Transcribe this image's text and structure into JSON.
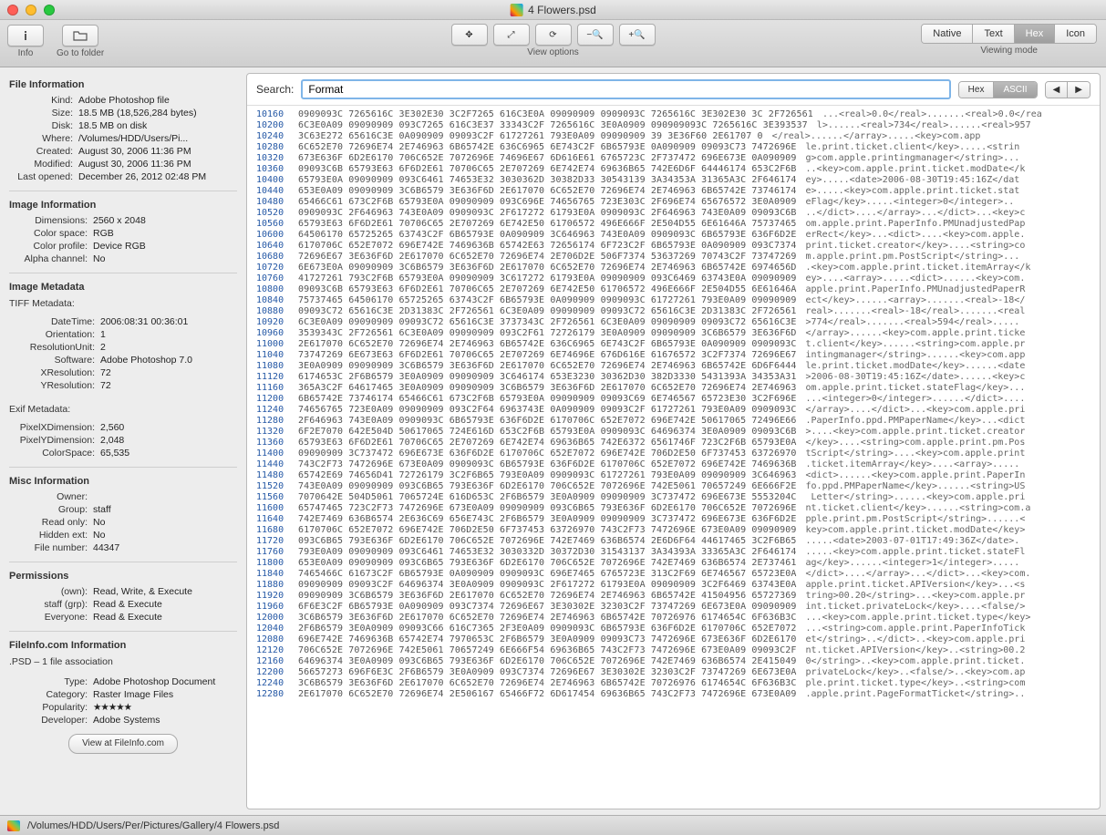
{
  "window": {
    "title": "4 Flowers.psd"
  },
  "toolbar": {
    "info_label": "Info",
    "folder_label": "Go to folder",
    "view_options_label": "View options",
    "viewing_mode_label": "Viewing mode",
    "modes": [
      "Native",
      "Text",
      "Hex",
      "Icon"
    ],
    "active_mode": "Hex"
  },
  "search": {
    "label": "Search:",
    "value": "Format",
    "type_options": [
      "Hex",
      "ASCII"
    ],
    "active_type": "ASCII"
  },
  "sidebar": {
    "file_info_header": "File Information",
    "file_info": {
      "Kind": "Adobe Photoshop file",
      "Size": "18.5 MB (18,526,284 bytes)",
      "Disk": "18.5 MB on disk",
      "Where": "/Volumes/HDD/Users/Pi...",
      "Created": "August 30, 2006 11:36 PM",
      "Modified": "August 30, 2006 11:36 PM",
      "Last opened": "December 26, 2012 02:48 PM"
    },
    "image_info_header": "Image Information",
    "image_info": {
      "Dimensions": "2560 x 2048",
      "Color space": "RGB",
      "Color profile": "Device RGB",
      "Alpha channel": "No"
    },
    "meta_header": "Image Metadata",
    "tiff_label": "TIFF Metadata:",
    "tiff": {
      "DateTime": "2006:08:31 00:36:01",
      "Orientation": "1",
      "ResolutionUnit": "2",
      "Software": "Adobe Photoshop 7.0",
      "XResolution": "72",
      "YResolution": "72"
    },
    "exif_label": "Exif Metadata:",
    "exif": {
      "PixelXDimension": "2,560",
      "PixelYDimension": "2,048",
      "ColorSpace": "65,535"
    },
    "misc_header": "Misc Information",
    "misc": {
      "Owner": "",
      "Group": "staff",
      "Read only": "No",
      "Hidden ext": "No",
      "File number": "44347"
    },
    "perm_header": "Permissions",
    "perm": {
      "(own)": "Read, Write, & Execute",
      "staff (grp)": "Read & Execute",
      "Everyone": "Read & Execute"
    },
    "fi_header": "FileInfo.com Information",
    "fi_assoc": ".PSD – 1 file association",
    "fi": {
      "Type": "Adobe Photoshop Document",
      "Category": "Raster Image Files",
      "Popularity": "★★★★★",
      "Developer": "Adobe Systems"
    },
    "fi_button": "View at FileInfo.com"
  },
  "hex": {
    "rows": [
      {
        "o": "10160",
        "b": "0909093C 7265616C 3E302E30 3C2F7265 616C3E0A 09090909 0909093C 7265616C 3E302E30 3C 2F726561",
        "a": "...<real>0.0</real>.......<real>0.0</rea"
      },
      {
        "o": "10200",
        "b": "6C3E0A09 09090909 093C7265 616C3E37 33343C2F 7265616C 3E0A0909 090909093C 7265616C 3E393537",
        "a": "l>......<real>734</real>......<real>957"
      },
      {
        "o": "10240",
        "b": "3C63E272 65616C3E 0A090909 09093C2F 61727261 793E0A09 09090909 39 3E36F60 2E61707 0",
        "a": "</real>......</array>.....<key>com.app"
      },
      {
        "o": "10280",
        "b": "6C652E70 72696E74 2E746963 6B65742E 636C6965 6E743C2F 6B65793E 0A090909 09093C73 7472696E",
        "a": "le.print.ticket.client</key>.....<strin"
      },
      {
        "o": "10320",
        "b": "673E636F 6D2E6170 706C652E 7072696E 74696E67 6D616E61 6765723C 2F737472 696E673E 0A090909",
        "a": "g>com.apple.printingmanager</string>..."
      },
      {
        "o": "10360",
        "b": "09093C6B 65793E63 6F6D2E61 70706C65 2E707269 6E742E74 69636B65 742E6D6F 64446174 653C2F6B",
        "a": "..<key>com.apple.print.ticket.modDate</k"
      },
      {
        "o": "10400",
        "b": "65793E0A 09090909 093C6461 74653E32 3030362D 30382D33 30543139 3A34353A 31365A3C 2F646174",
        "a": "ey>.....<date>2006-08-30T19:45:16Z</dat"
      },
      {
        "o": "10440",
        "b": "653E0A09 09090909 3C6B6579 3E636F6D 2E617070 6C652E70 72696E74 2E746963 6B65742E 73746174",
        "a": "e>.....<key>com.apple.print.ticket.stat"
      },
      {
        "o": "10480",
        "b": "65466C61 673C2F6B 65793E0A 09090909 093C696E 74656765 723E303C 2F696E74 65676572 3E0A0909",
        "a": "eFlag</key>.....<integer>0</integer>.."
      },
      {
        "o": "10520",
        "b": "0909093C 2F646963 743E0A09 0909093C 2F617272 61793E0A 0909093C 2F646963 743E0A09 09093C6B",
        "a": "..</dict>....</array>...</dict>...<key>c"
      },
      {
        "o": "10560",
        "b": "65793E63 6F6D2E61 70706C65 2E707269 6E742E50 61706572 496E666F 2E504D55 6E61646A 75737465",
        "a": "om.apple.print.PaperInfo.PMUnadjustedPap"
      },
      {
        "o": "10600",
        "b": "64506170 65725265 63743C2F 6B65793E 0A090909 3C646963 743E0A09 0909093C 6B65793E 636F6D2E",
        "a": "erRect</key>...<dict>....<key>com.apple."
      },
      {
        "o": "10640",
        "b": "6170706C 652E7072 696E742E 7469636B 65742E63 72656174 6F723C2F 6B65793E 0A090909 093C7374",
        "a": "print.ticket.creator</key>....<string>co"
      },
      {
        "o": "10680",
        "b": "72696E67 3E636F6D 2E617070 6C652E70 72696E74 2E706D2E 506F7374 53637269 70743C2F 73747269",
        "a": "m.apple.print.pm.PostScript</string>..."
      },
      {
        "o": "10720",
        "b": "6E673E0A 09090909 3C6B6579 3E636F6D 2E617070 6C652E70 72696E74 2E746963 6B65742E 6974656D",
        "a": ".<key>com.apple.print.ticket.itemArray</k"
      },
      {
        "o": "10760",
        "b": "41727261 793C2F6B 65793E0A 09090909 3C617272 61793E0A 09090909 093C6469 63743E0A 09090909",
        "a": "ey>....<array>.....<dict>......<key>com."
      },
      {
        "o": "10800",
        "b": "09093C6B 65793E63 6F6D2E61 70706C65 2E707269 6E742E50 61706572 496E666F 2E504D55 6E61646A",
        "a": "apple.print.PaperInfo.PMUnadjustedPaperR"
      },
      {
        "o": "10840",
        "b": "75737465 64506170 65725265 63743C2F 6B65793E 0A090909 0909093C 61727261 793E0A09 09090909",
        "a": "ect</key>......<array>.......<real>-18</"
      },
      {
        "o": "10880",
        "b": "09093C72 65616C3E 2D31383C 2F726561 6C3E0A09 09090909 09093C72 65616C3E 2D31383C 2F726561",
        "a": "real>.......<real>-18</real>.......<real"
      },
      {
        "o": "10920",
        "b": "6C3E0A09 09090909 09093C72 65616C3E 3737343C 2F726561 6C3E0A09 09090909 09093C72 65616C3E",
        "a": ">774</real>.......<real>594</real>....."
      },
      {
        "o": "10960",
        "b": "3539343C 2F726561 6C3E0A09 09090909 093C2F61 72726179 3E0A0909 09090909 3C6B6579 3E636F6D",
        "a": "</array>......<key>com.apple.print.ticke"
      },
      {
        "o": "11000",
        "b": "2E617070 6C652E70 72696E74 2E746963 6B65742E 636C6965 6E743C2F 6B65793E 0A090909 0909093C",
        "a": "t.client</key>......<string>com.apple.pr"
      },
      {
        "o": "11040",
        "b": "73747269 6E673E63 6F6D2E61 70706C65 2E707269 6E74696E 676D616E 61676572 3C2F7374 72696E67",
        "a": "intingmanager</string>......<key>com.app"
      },
      {
        "o": "11080",
        "b": "3E0A0909 09090909 3C6B6579 3E636F6D 2E617070 6C652E70 72696E74 2E746963 6B65742E 6D6F6444",
        "a": "le.print.ticket.modDate</key>......<date"
      },
      {
        "o": "11120",
        "b": "6174653C 2F6B6579 3E0A0909 09090909 3C646174 653E3230 30362D30 382D3330 5431393A 34353A31",
        "a": ">2006-08-30T19:45:16Z</date>......<key>c"
      },
      {
        "o": "11160",
        "b": "365A3C2F 64617465 3E0A0909 09090909 3C6B6579 3E636F6D 2E617070 6C652E70 72696E74 2E746963",
        "a": "om.apple.print.ticket.stateFlag</key>..."
      },
      {
        "o": "11200",
        "b": "6B65742E 73746174 65466C61 673C2F6B 65793E0A 09090909 09093C69 6E746567 65723E30 3C2F696E",
        "a": "...<integer>0</integer>......</dict>...."
      },
      {
        "o": "11240",
        "b": "74656765 723E0A09 09090909 093C2F64 6963743E 0A090909 09093C2F 61727261 793E0A09 0909093C",
        "a": "</array>....</dict>...<key>com.apple.pri"
      },
      {
        "o": "11280",
        "b": "2F646963 743E0A09 0909093C 6B65793E 636F6D2E 6170706C 652E7072 696E742E 50617065 72496E66",
        "a": ".PaperInfo.ppd.PMPaperName</key>...<dict"
      },
      {
        "o": "11320",
        "b": "6F2E7070 642E504D 50617065 724E616D 653C2F6B 65793E0A 0909093C 64696374 3E0A0909 09093C6B",
        "a": ">....<key>com.apple.print.ticket.creator"
      },
      {
        "o": "11360",
        "b": "65793E63 6F6D2E61 70706C65 2E707269 6E742E74 69636B65 742E6372 6561746F 723C2F6B 65793E0A",
        "a": "</key>....<string>com.apple.print.pm.Pos"
      },
      {
        "o": "11400",
        "b": "09090909 3C737472 696E673E 636F6D2E 6170706C 652E7072 696E742E 706D2E50 6F737453 63726970",
        "a": "tScript</string>....<key>com.apple.print"
      },
      {
        "o": "11440",
        "b": "743C2F73 7472696E 673E0A09 0909093C 6B65793E 636F6D2E 6170706C 652E7072 696E742E 7469636B",
        "a": ".ticket.itemArray</key>....<array>....."
      },
      {
        "o": "11480",
        "b": "65742E69 74656D41 72726179 3C2F6B65 793E0A09 0909093C 61727261 793E0A09 09090909 3C646963",
        "a": "<dict>......<key>com.apple.print.PaperIn"
      },
      {
        "o": "11520",
        "b": "743E0A09 09090909 093C6B65 793E636F 6D2E6170 706C652E 7072696E 742E5061 70657249 6E666F2E",
        "a": "fo.ppd.PMPaperName</key>......<string>US"
      },
      {
        "o": "11560",
        "b": "7070642E 504D5061 7065724E 616D653C 2F6B6579 3E0A0909 09090909 3C737472 696E673E 5553204C",
        "a": " Letter</string>......<key>com.apple.pri"
      },
      {
        "o": "11600",
        "b": "65747465 723C2F73 7472696E 673E0A09 09090909 093C6B65 793E636F 6D2E6170 706C652E 7072696E",
        "a": "nt.ticket.client</key>......<string>com.a"
      },
      {
        "o": "11640",
        "b": "742E7469 636B6574 2E636C69 656E743C 2F6B6579 3E0A0909 09090909 3C737472 696E673E 636F6D2E",
        "a": "pple.print.pm.PostScript</string>......<"
      },
      {
        "o": "11680",
        "b": "6170706C 652E7072 696E742E 706D2E50 6F737453 63726970 743C2F73 7472696E 673E0A09 09090909",
        "a": "key>com.apple.print.ticket.modDate</key>"
      },
      {
        "o": "11720",
        "b": "093C6B65 793E636F 6D2E6170 706C652E 7072696E 742E7469 636B6574 2E6D6F64 44617465 3C2F6B65",
        "a": ".....<date>2003-07-01T17:49:36Z</date>."
      },
      {
        "o": "11760",
        "b": "793E0A09 09090909 093C6461 74653E32 3030332D 30372D30 31543137 3A34393A 33365A3C 2F646174",
        "a": ".....<key>com.apple.print.ticket.stateFl"
      },
      {
        "o": "11800",
        "b": "653E0A09 09090909 093C6B65 793E636F 6D2E6170 706C652E 7072696E 742E7469 636B6574 2E737461",
        "a": "ag</key>......<integer>1</integer>....."
      },
      {
        "o": "11840",
        "b": "7465466C 61673C2F 6B65793E 0A090909 0909093C 696E7465 6765723E 313C2F69 6E746567 65723E0A",
        "a": "</dict>....</array>...</dict>...<key>com."
      },
      {
        "o": "11880",
        "b": "09090909 09093C2F 64696374 3E0A0909 0909093C 2F617272 61793E0A 09090909 3C2F6469 63743E0A",
        "a": "apple.print.ticket.APIVersion</key>...<s"
      },
      {
        "o": "11920",
        "b": "09090909 3C6B6579 3E636F6D 2E617070 6C652E70 72696E74 2E746963 6B65742E 41504956 65727369",
        "a": "tring>00.20</string>...<key>com.apple.pr"
      },
      {
        "o": "11960",
        "b": "6F6E3C2F 6B65793E 0A090909 093C7374 72696E67 3E30302E 32303C2F 73747269 6E673E0A 09090909",
        "a": "int.ticket.privateLock</key>....<false/>"
      },
      {
        "o": "12000",
        "b": "3C6B6579 3E636F6D 2E617070 6C652E70 72696E74 2E746963 6B65742E 70726976 6174654C 6F636B3C",
        "a": "...<key>com.apple.print.ticket.type</key>"
      },
      {
        "o": "12040",
        "b": "2F6B6579 3E0A0909 09093C66 616C7365 2F3E0A09 0909093C 6B65793E 636F6D2E 6170706C 652E7072",
        "a": "...<string>com.apple.print.PaperInfoTick"
      },
      {
        "o": "12080",
        "b": "696E742E 7469636B 65742E74 7970653C 2F6B6579 3E0A0909 09093C73 7472696E 673E636F 6D2E6170",
        "a": "et</string>..</dict>..<key>com.apple.pri"
      },
      {
        "o": "12120",
        "b": "706C652E 7072696E 742E5061 70657249 6E666F54 69636B65 743C2F73 7472696E 673E0A09 09093C2F",
        "a": "nt.ticket.APIVersion</key>..<string>00.2"
      },
      {
        "o": "12160",
        "b": "64696374 3E0A0909 093C6B65 793E636F 6D2E6170 706C652E 7072696E 742E7469 636B6574 2E415049",
        "a": "0</string>..<key>com.apple.print.ticket."
      },
      {
        "o": "12200",
        "b": "56657273 696F6E3C 2F6B6579 3E0A0909 093C7374 72696E67 3E30302E 32303C2F 73747269 6E673E0A",
        "a": "privateLock</key>..<false/>..<key>com.ap"
      },
      {
        "o": "12240",
        "b": "3C6B6579 3E636F6D 2E617070 6C652E70 72696E74 2E746963 6B65742E 70726976 6174654C 6F636B3C",
        "a": "ple.print.ticket.type</key>..<string>com"
      },
      {
        "o": "12280",
        "b": "2E617070 6C652E70 72696E74 2E506167 65466F72 6D617454 69636B65 743C2F73 7472696E 673E0A09",
        "a": ".apple.print.PageFormatTicket</string>.."
      }
    ]
  },
  "status": {
    "path": "/Volumes/HDD/Users/Per/Pictures/Gallery/4 Flowers.psd"
  }
}
